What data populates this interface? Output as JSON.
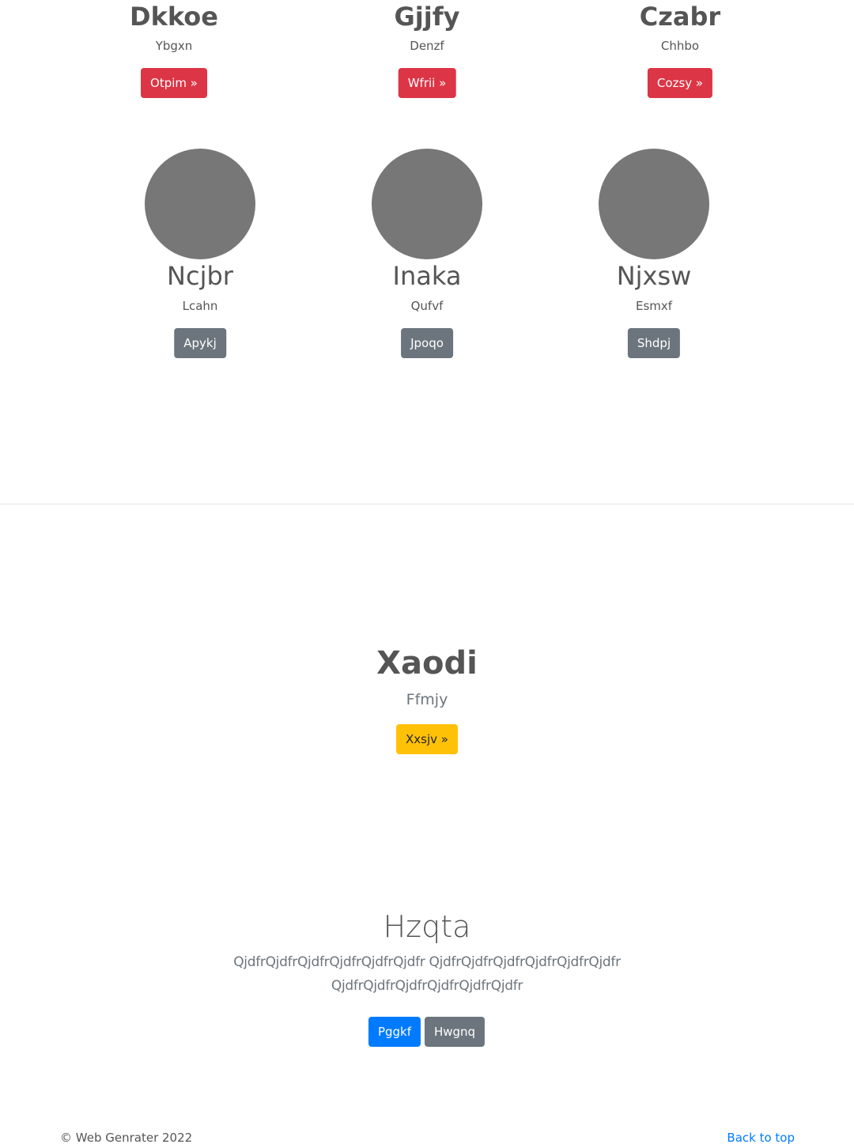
{
  "top_row": [
    {
      "title": "Dkkoe",
      "subtitle": "Ybgxn",
      "button": "Otpim »"
    },
    {
      "title": "Gjjfy",
      "subtitle": "Denzf",
      "button": "Wfrii »"
    },
    {
      "title": "Czabr",
      "subtitle": "Chhbo",
      "button": "Cozsy »"
    }
  ],
  "profiles": [
    {
      "name": "Ncjbr",
      "subtitle": "Lcahn",
      "button": "Apykj"
    },
    {
      "name": "Inaka",
      "subtitle": "Qufvf",
      "button": "Jpoqo"
    },
    {
      "name": "Njxsw",
      "subtitle": "Esmxf",
      "button": "Shdpj"
    }
  ],
  "feature": {
    "title": "Xaodi",
    "subtitle": "Ffmjy",
    "button": "Xxsjv »"
  },
  "hero": {
    "title": "Hzqta",
    "line1": "QjdfrQjdfrQjdfrQjdfrQjdfrQjdfr QjdfrQjdfrQjdfrQjdfrQjdfrQjdfr",
    "line2": "QjdfrQjdfrQjdfrQjdfrQjdfrQjdfr",
    "primary_button": "Pggkf",
    "secondary_button": "Hwgnq"
  },
  "footer": {
    "copyright": "© Web Genrater 2022",
    "back_to_top": "Back to top"
  },
  "colors": {
    "danger": "#dc3545",
    "secondary": "#6c757d",
    "warning": "#ffc107",
    "primary": "#007bff",
    "link": "#007bff"
  }
}
